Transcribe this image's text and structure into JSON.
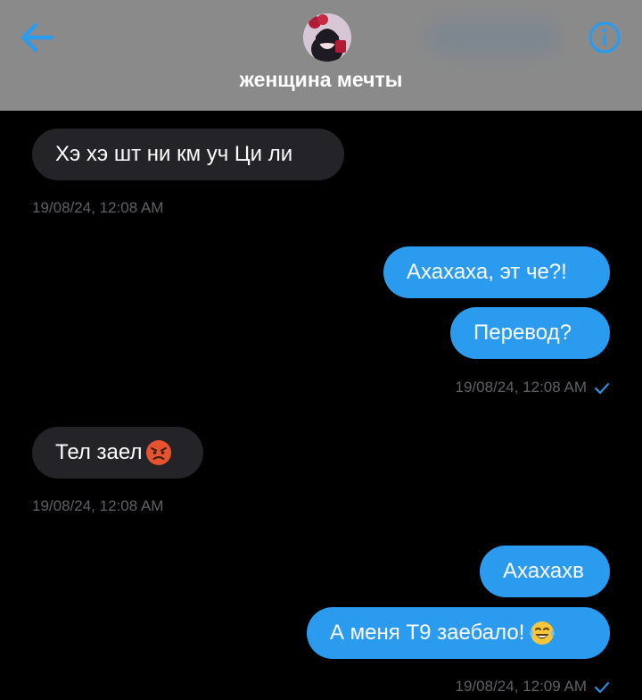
{
  "header": {
    "contact_name": "женщина мечты",
    "back_icon": "back-arrow-icon",
    "info_icon": "info-icon",
    "accent_color": "#2b9bf0"
  },
  "messages": [
    {
      "direction": "incoming",
      "text": "Хэ хэ шт ни км уч Ци ли"
    },
    {
      "direction": "incoming",
      "timestamp": "19/08/24, 12:08 AM"
    },
    {
      "direction": "outgoing",
      "text": "Ахахаха, эт че?!"
    },
    {
      "direction": "outgoing",
      "text": "Перевод?"
    },
    {
      "direction": "outgoing",
      "timestamp": "19/08/24, 12:08 AM",
      "status": "sent-check-icon"
    },
    {
      "direction": "incoming",
      "text": "Тел заел",
      "emoji": "angry-face-emoji"
    },
    {
      "direction": "incoming",
      "timestamp": "19/08/24, 12:08 AM"
    },
    {
      "direction": "outgoing",
      "text": "Ахахахв"
    },
    {
      "direction": "outgoing",
      "text": "А меня Т9 заебало!",
      "emoji": "laughing-tears-emoji"
    },
    {
      "direction": "outgoing",
      "timestamp": "19/08/24, 12:09 AM",
      "status": "sent-check-icon"
    }
  ]
}
